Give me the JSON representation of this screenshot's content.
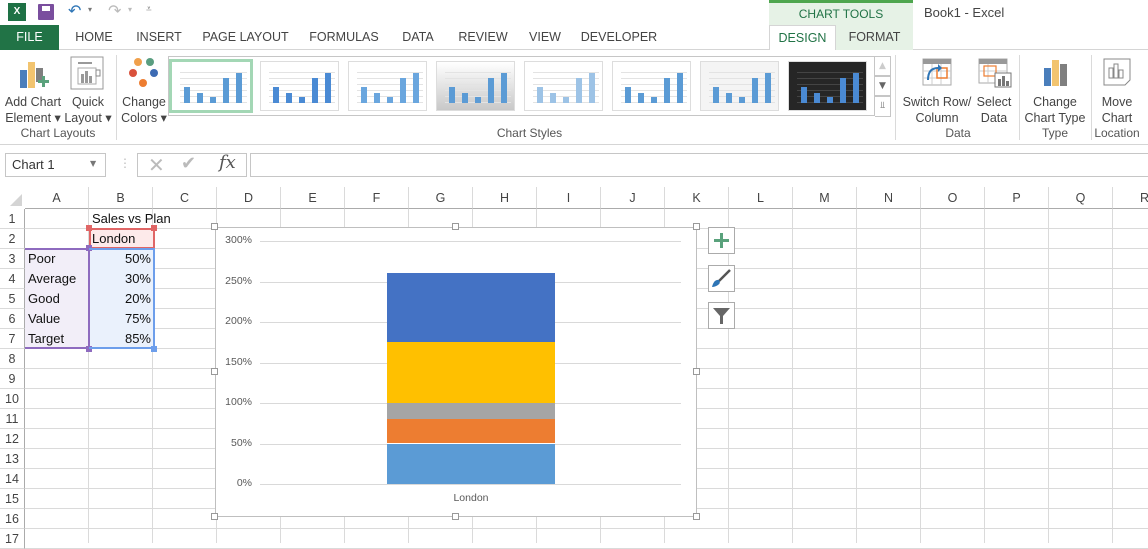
{
  "app": {
    "window_title": "Book1 - Excel",
    "icon": "excel-icon",
    "quick_access": [
      "save-icon",
      "undo-icon",
      "redo-icon",
      "customize-icon"
    ],
    "contextual_group": "CHART TOOLS"
  },
  "tabs": [
    {
      "label": "FILE"
    },
    {
      "label": "HOME"
    },
    {
      "label": "INSERT"
    },
    {
      "label": "PAGE LAYOUT"
    },
    {
      "label": "FORMULAS"
    },
    {
      "label": "DATA"
    },
    {
      "label": "REVIEW"
    },
    {
      "label": "VIEW"
    },
    {
      "label": "DEVELOPER"
    },
    {
      "label": "DESIGN",
      "active": true
    },
    {
      "label": "FORMAT"
    }
  ],
  "ribbon": {
    "add_chart_element": {
      "line1": "Add Chart",
      "line2": "Element ▾"
    },
    "quick_layout": {
      "line1": "Quick",
      "line2": "Layout ▾"
    },
    "change_colors": {
      "line1": "Change",
      "line2": "Colors ▾"
    },
    "switch_row_column": {
      "line1": "Switch Row/",
      "line2": "Column"
    },
    "select_data": {
      "line1": "Select",
      "line2": "Data"
    },
    "change_chart_type": {
      "line1": "Change",
      "line2": "Chart Type"
    },
    "move_chart": {
      "line1": "Move",
      "line2": "Chart"
    },
    "groups": {
      "chart_layouts": "Chart Layouts",
      "chart_styles": "Chart Styles",
      "data": "Data",
      "type": "Type",
      "location": "Location"
    },
    "chart_style_count": 8,
    "selected_style": 1
  },
  "formula_bar": {
    "name_box": "Chart 1",
    "cancel_icon": "✕",
    "enter_icon": "✔",
    "fx_label": "fx",
    "formula": ""
  },
  "sheet": {
    "columns": [
      "A",
      "B",
      "C",
      "D",
      "E",
      "F",
      "G",
      "H",
      "I",
      "J",
      "K",
      "L",
      "M",
      "N",
      "O",
      "P",
      "Q",
      "R"
    ],
    "rows": [
      "1",
      "2",
      "3",
      "4",
      "5",
      "6",
      "7",
      "8",
      "9",
      "10",
      "11",
      "12",
      "13",
      "14",
      "15",
      "16",
      "17"
    ],
    "cells": {
      "B1": "Sales vs Plan",
      "B2": "London",
      "A3": "Poor",
      "B3": "50%",
      "A4": "Average",
      "B4": "30%",
      "A5": "Good",
      "B5": "20%",
      "A6": "Value",
      "B6": "75%",
      "A7": "Target",
      "B7": "85%"
    }
  },
  "chart_side_buttons": [
    "chart-elements-plus-icon",
    "chart-styles-brush-icon",
    "chart-filters-funnel-icon"
  ],
  "chart_data": {
    "type": "bar",
    "stacked": true,
    "title": "",
    "xlabel": "",
    "ylabel": "",
    "categories": [
      "London"
    ],
    "series": [
      {
        "name": "Poor",
        "values": [
          50
        ],
        "color": "#5b9bd5"
      },
      {
        "name": "Average",
        "values": [
          30
        ],
        "color": "#ed7d31"
      },
      {
        "name": "Good",
        "values": [
          20
        ],
        "color": "#a5a5a5"
      },
      {
        "name": "Value",
        "values": [
          75
        ],
        "color": "#ffc000"
      },
      {
        "name": "Target",
        "values": [
          85
        ],
        "color": "#4472c4"
      }
    ],
    "ylim": [
      0,
      300
    ],
    "yticks": [
      "0%",
      "50%",
      "100%",
      "150%",
      "200%",
      "250%",
      "300%"
    ],
    "ytick_values": [
      0,
      50,
      100,
      150,
      200,
      250,
      300
    ],
    "grid": true,
    "legend": "none"
  },
  "colors": {
    "excel_green": "#217346",
    "chart_tools_bg": "#e6f2e6",
    "range_red": "#e06666",
    "range_purple": "#8e6bbf",
    "range_blue": "#6d9eeb"
  }
}
